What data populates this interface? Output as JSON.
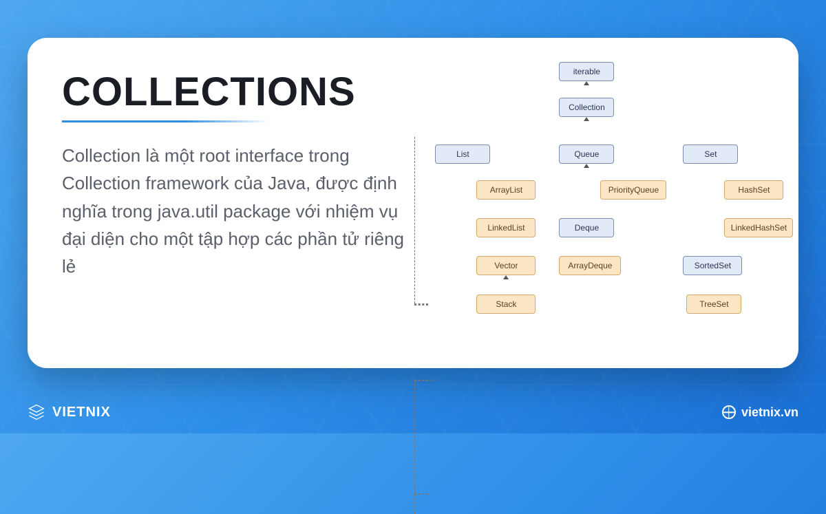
{
  "title": "COLLECTIONS",
  "description": "Collection là một root interface trong Collection framework của Java, được định nghĩa trong java.util package với nhiệm vụ đại diện cho một tập hợp các phần tử riêng lẻ",
  "brand": "VIETNIX",
  "site": "vietnix.vn",
  "diagram": {
    "iterable": "iterable",
    "collection": "Collection",
    "list": "List",
    "queue": "Queue",
    "set": "Set",
    "arraylist": "ArrayList",
    "linkedlist": "LinkedList",
    "vector": "Vector",
    "stack": "Stack",
    "priorityqueue": "PriorityQueue",
    "deque": "Deque",
    "arraydeque": "ArrayDeque",
    "hashset": "HashSet",
    "linkedhashset": "LinkedHashSet",
    "sortedset": "SortedSet",
    "treeset": "TreeSet"
  }
}
